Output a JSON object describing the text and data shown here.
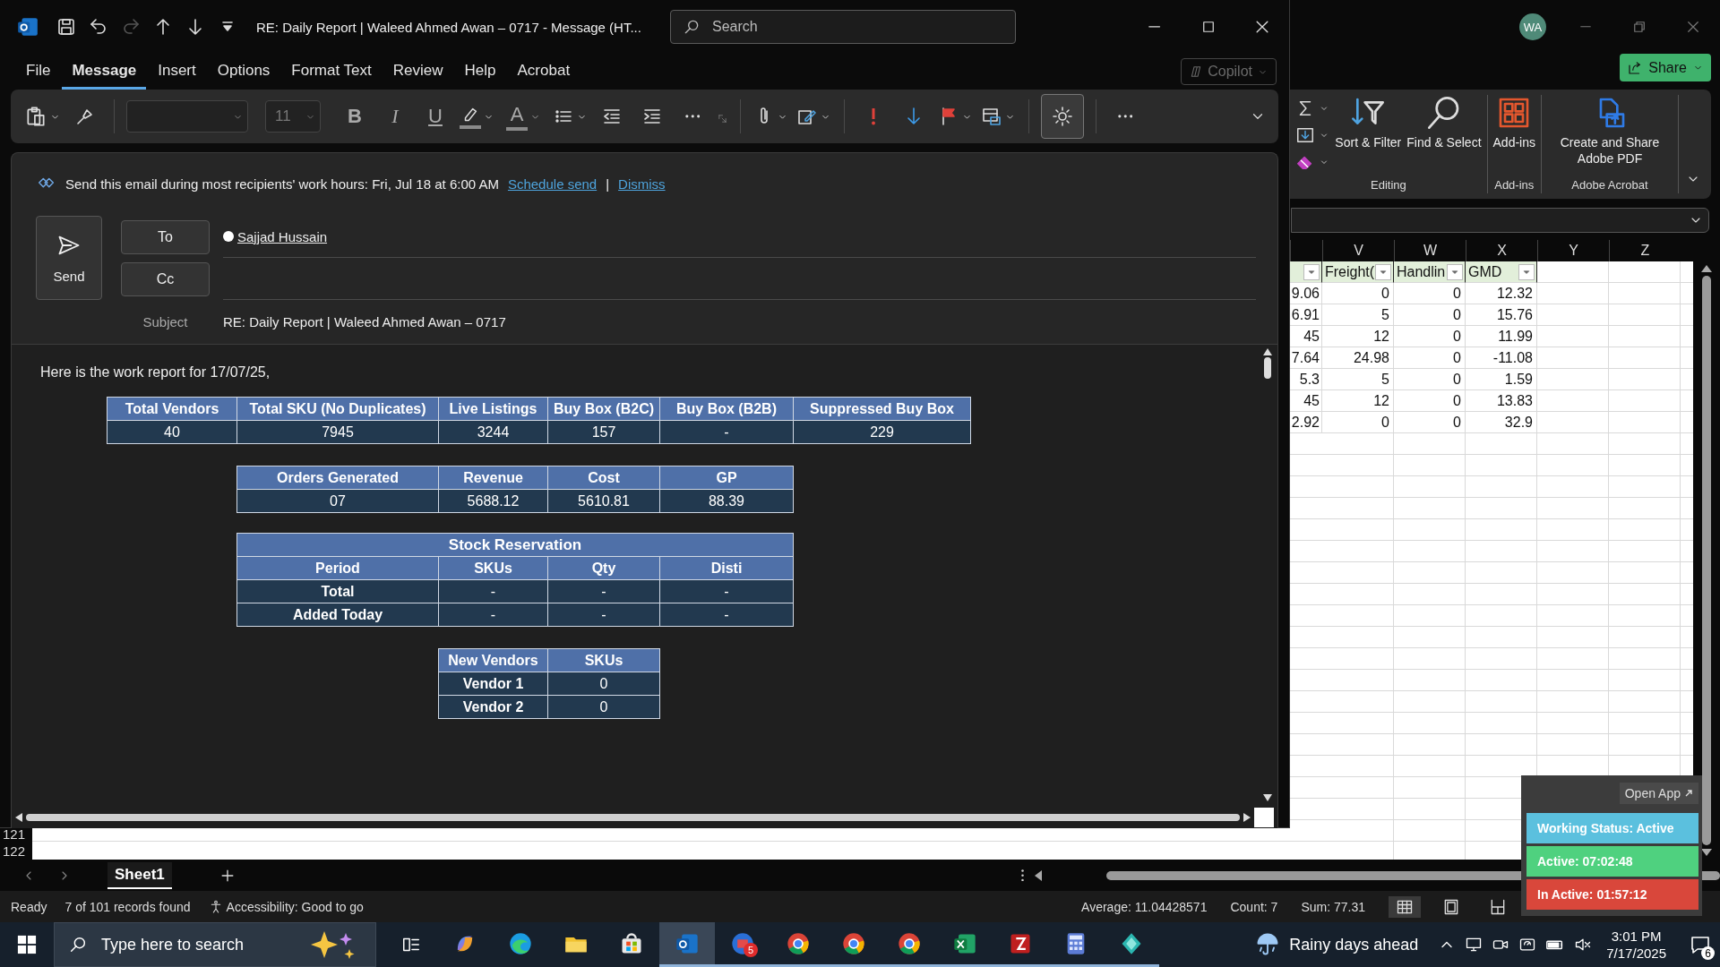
{
  "outlook": {
    "title": "RE: Daily Report | Waleed Ahmed Awan – 0717  -  Message (HT...",
    "quick_access": [
      {
        "kind": "save",
        "disabled": false
      },
      {
        "kind": "undo",
        "disabled": false
      },
      {
        "kind": "redo",
        "disabled": true
      },
      {
        "kind": "up",
        "disabled": false
      },
      {
        "kind": "down",
        "disabled": false
      },
      {
        "kind": "customize",
        "disabled": false
      }
    ],
    "search": {
      "placeholder": "Search"
    },
    "tabs": [
      {
        "label": "File",
        "selected": false
      },
      {
        "label": "Message",
        "selected": true
      },
      {
        "label": "Insert",
        "selected": false
      },
      {
        "label": "Options",
        "selected": false
      },
      {
        "label": "Format Text",
        "selected": false
      },
      {
        "label": "Review",
        "selected": false
      },
      {
        "label": "Help",
        "selected": false
      },
      {
        "label": "Acrobat",
        "selected": false
      }
    ],
    "copilot": {
      "label": "Copilot",
      "disabled": true
    },
    "toolbar": [
      [
        {
          "kind": "paste",
          "on": false
        },
        {
          "kind": "format-painter",
          "on": false
        }
      ],
      [
        {
          "kind": "font-box",
          "on": false
        },
        {
          "kind": "size-box",
          "value": "11",
          "on": false
        },
        {
          "kind": "bold",
          "label": "B",
          "on": false
        },
        {
          "kind": "italic",
          "label": "I",
          "on": false
        },
        {
          "kind": "underline",
          "label": "U",
          "on": false
        },
        {
          "kind": "highlight",
          "on": false
        },
        {
          "kind": "font-color",
          "label": "A",
          "on": false
        },
        {
          "kind": "bullets",
          "on": false
        },
        {
          "kind": "outdent",
          "on": false
        },
        {
          "kind": "indent",
          "on": false
        },
        {
          "kind": "more",
          "on": false
        },
        {
          "kind": "launcher",
          "on": false
        }
      ],
      [
        {
          "kind": "attach",
          "on": false
        },
        {
          "kind": "signature",
          "on": false
        }
      ],
      [
        {
          "kind": "high-importance",
          "on": false
        },
        {
          "kind": "low-importance",
          "on": false
        },
        {
          "kind": "flag",
          "on": false
        },
        {
          "kind": "move",
          "on": false
        }
      ],
      [
        {
          "kind": "background",
          "on": true
        }
      ],
      [
        {
          "kind": "more",
          "on": false
        }
      ]
    ],
    "suggestion": {
      "text": "Send this email during most recipients' work hours: Fri, Jul 18 at 6:00 AM",
      "link": "Schedule send",
      "separator": "|",
      "dismiss": "Dismiss"
    },
    "send": "Send",
    "to": "To",
    "cc": "Cc",
    "recipients": [
      "Sajjad Hussain"
    ],
    "subject_label": "Subject",
    "subject": "RE: Daily Report | Waleed Ahmed Awan – 0717",
    "body": {
      "intro": "Here is the work report for 17/07/25,",
      "tables": [
        {
          "row_headers": false,
          "columns": [
            "Total Vendors",
            "Total SKU (No Duplicates)",
            "Live Listings",
            "Buy Box (B2C)",
            "Buy Box (B2B)",
            "Suppressed Buy Box"
          ],
          "rows": [
            [
              "40",
              "7945",
              "3244",
              "157",
              "-",
              "229"
            ]
          ]
        },
        {
          "row_headers": false,
          "columns": [
            "Orders Generated",
            "Revenue",
            "Cost",
            "GP"
          ],
          "rows": [
            [
              "07",
              "5688.12",
              "5610.81",
              "88.39"
            ]
          ]
        },
        {
          "row_headers": true,
          "title": "Stock Reservation",
          "columns": [
            "Period",
            "SKUs",
            "Qty",
            "Disti"
          ],
          "rows": [
            [
              "Total",
              "-",
              "-",
              "-"
            ],
            [
              "Added Today",
              "-",
              "-",
              "-"
            ]
          ]
        },
        {
          "row_headers": true,
          "columns": [
            "New Vendors",
            "SKUs"
          ],
          "rows": [
            [
              "Vendor 1",
              "0"
            ],
            [
              "Vendor 2",
              "0"
            ]
          ]
        }
      ]
    }
  },
  "excel": {
    "avatar": "WA",
    "share": "Share",
    "ribbon_groups": [
      {
        "label": "Editing",
        "buttons": [
          {
            "kind": "autosum"
          },
          {
            "kind": "fill"
          },
          {
            "kind": "clear"
          },
          {
            "kind": "sort-filter",
            "label": "Sort & Filter"
          },
          {
            "kind": "find-select",
            "label": "Find & Select"
          }
        ]
      },
      {
        "label": "Add-ins",
        "buttons": [
          {
            "kind": "addins",
            "label": "Add-ins"
          }
        ]
      },
      {
        "label": "Adobe Acrobat",
        "buttons": [
          {
            "kind": "pdf",
            "label": "Create and Share Adobe PDF"
          }
        ]
      }
    ],
    "columns": [
      "V",
      "W",
      "X",
      "Y",
      "Z"
    ],
    "table_headers": [
      "Freight(",
      "Handlin",
      "GMD"
    ],
    "cut_column": [
      "9.06",
      "6.91",
      "45",
      "7.64",
      "5.3",
      "45",
      "2.92"
    ],
    "rows": [
      [
        "0",
        "0",
        "12.32"
      ],
      [
        "5",
        "0",
        "15.76"
      ],
      [
        "12",
        "0",
        "11.99"
      ],
      [
        "24.98",
        "0",
        "-11.08"
      ],
      [
        "5",
        "0",
        "1.59"
      ],
      [
        "12",
        "0",
        "13.83"
      ],
      [
        "0",
        "0",
        "32.9"
      ]
    ],
    "row_numbers": [
      "121",
      "122"
    ],
    "sheets": [
      {
        "name": "Sheet1",
        "selected": true
      }
    ],
    "status": {
      "ready": "Ready",
      "filter": "7 of 101 records found",
      "accessibility": "Accessibility: Good to go",
      "average": "Average: 11.04428571",
      "count": "Count: 7",
      "sum": "Sum: 77.31"
    },
    "views": [
      {
        "kind": "normal",
        "selected": true
      },
      {
        "kind": "page-layout",
        "selected": false
      },
      {
        "kind": "page-break",
        "selected": false
      }
    ]
  },
  "tracker": {
    "open": "Open App",
    "statuses": [
      {
        "text": "Working Status: Active",
        "color": "#5bc0de"
      },
      {
        "text": "Active: 07:02:48",
        "color": "#4fd17f"
      },
      {
        "text": "In Active: 01:57:12",
        "color": "#d9473b"
      }
    ]
  },
  "taskbar": {
    "search": {
      "placeholder": "Type here to search"
    },
    "apps": [
      {
        "kind": "copilot",
        "running": false,
        "active": false
      },
      {
        "kind": "edge",
        "running": false,
        "active": false
      },
      {
        "kind": "explorer",
        "running": false,
        "active": false
      },
      {
        "kind": "store",
        "running": false,
        "active": false
      },
      {
        "kind": "outlook",
        "running": true,
        "active": true
      },
      {
        "kind": "calendar-app",
        "running": true,
        "active": false,
        "badge": "5"
      },
      {
        "kind": "chrome",
        "running": true,
        "active": false
      },
      {
        "kind": "chrome",
        "running": true,
        "active": false
      },
      {
        "kind": "chrome",
        "running": true,
        "active": false
      },
      {
        "kind": "excel",
        "running": true,
        "active": false
      },
      {
        "kind": "filezilla",
        "running": true,
        "active": false
      },
      {
        "kind": "calculator",
        "running": true,
        "active": false
      },
      {
        "kind": "diamond-app",
        "running": true,
        "active": false
      }
    ],
    "weather": "Rainy days ahead",
    "time": "3:01 PM",
    "date": "7/17/2025",
    "notifications": "6"
  }
}
